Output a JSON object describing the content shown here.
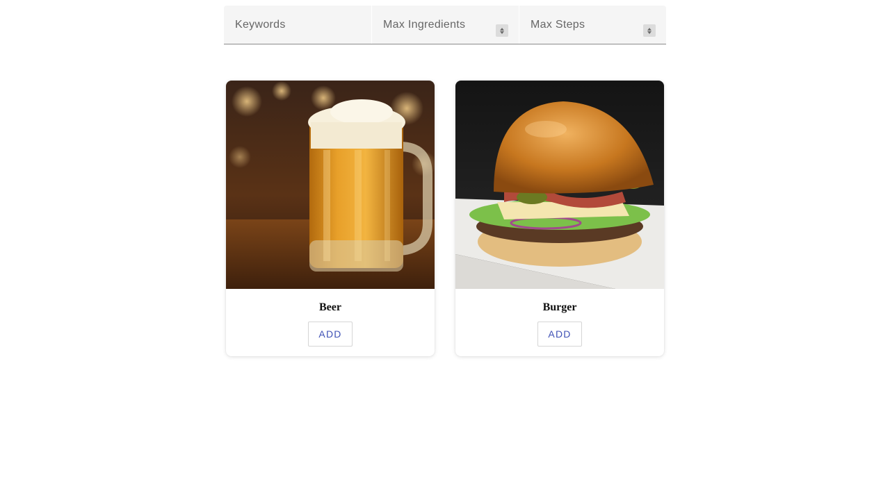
{
  "filters": {
    "keywords_placeholder": "Keywords",
    "max_ingredients_placeholder": "Max Ingredients",
    "max_steps_placeholder": "Max Steps"
  },
  "recipes": [
    {
      "title": "Beer",
      "add_label": "ADD",
      "image": "beer-mug-photo"
    },
    {
      "title": "Burger",
      "add_label": "ADD",
      "image": "burger-photo"
    }
  ],
  "colors": {
    "accent": "#3f51b5",
    "filter_bg": "#f5f5f5"
  }
}
